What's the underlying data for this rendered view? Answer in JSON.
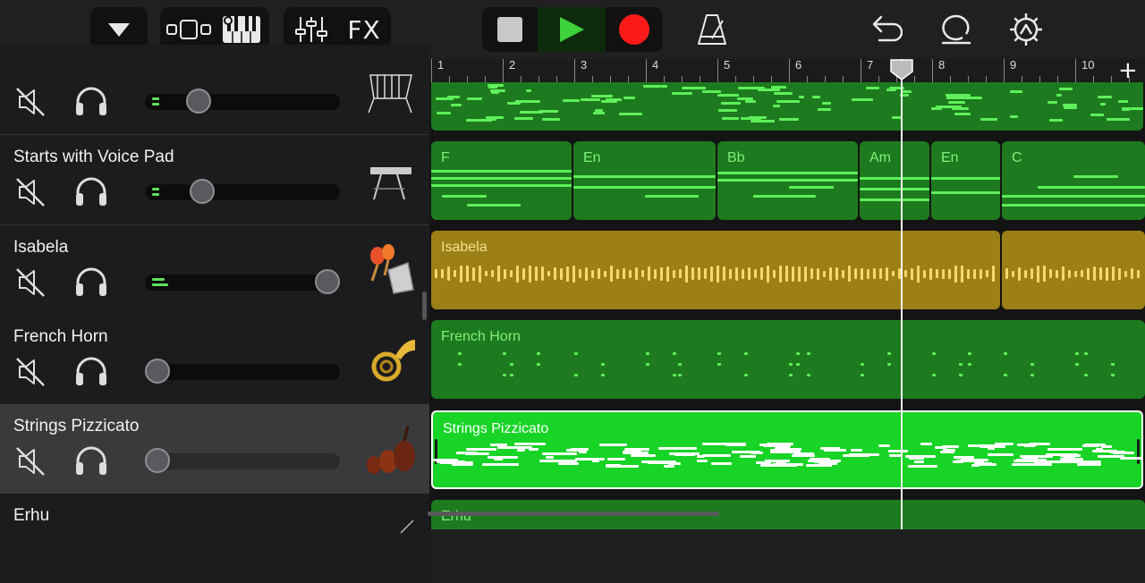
{
  "toolbar": {
    "fx_label": "FX",
    "colors": {
      "play": "#3ed23a",
      "record": "#ff1a1a"
    }
  },
  "tracks": [
    {
      "name": "",
      "instrument": "harp-icon"
    },
    {
      "name": "Starts with Voice Pad",
      "instrument": "keyboard-icon"
    },
    {
      "name": "Isabela",
      "instrument": "maracas-icon"
    },
    {
      "name": "French Horn",
      "instrument": "french-horn-icon"
    },
    {
      "name": "Strings Pizzicato",
      "instrument": "strings-icon"
    },
    {
      "name": "Erhu",
      "instrument": "erhu-icon"
    }
  ],
  "ruler": {
    "bars": [
      "1",
      "2",
      "3",
      "4",
      "5",
      "6",
      "7",
      "8",
      "9",
      "10"
    ]
  },
  "regions": {
    "chords": [
      "F",
      "En",
      "Bb",
      "Am",
      "En",
      "C"
    ],
    "isabela": "Isabela",
    "french_horn": "French Horn",
    "strings": "Strings Pizzicato",
    "erhu": "Erhu"
  },
  "colors": {
    "region_green": "#1e7a1e",
    "region_bright": "#17d426",
    "region_gold": "#9c7f17",
    "note_green": "#5ef05a"
  }
}
